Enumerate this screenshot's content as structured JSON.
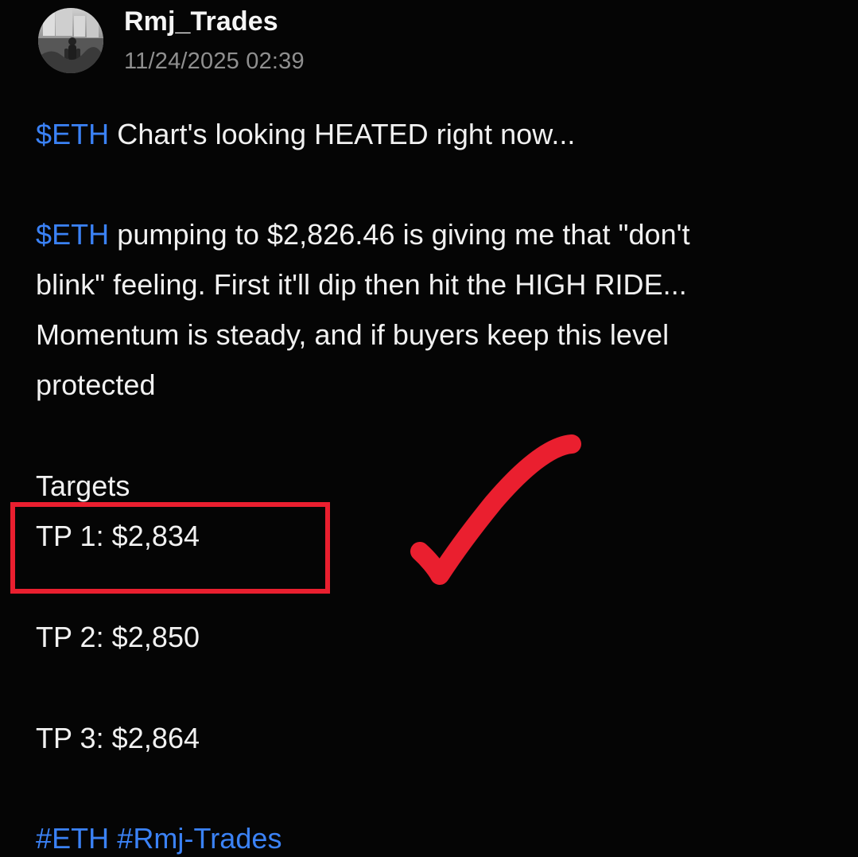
{
  "post": {
    "author": "Rmj_Trades",
    "timestamp": "11/24/2025 02:39",
    "headline": {
      "ticker": "$ETH",
      "text": " Chart's looking HEATED right now..."
    },
    "body": {
      "line1_ticker": "$ETH",
      "line1_text": " pumping to $2,826.46 is giving me that \"don't",
      "line2": "blink\" feeling. First it'll dip then hit the HIGH RIDE...",
      "line3": "Momentum is steady, and if buyers keep this level",
      "line4": "protected"
    },
    "targets_label": "Targets",
    "targets": [
      "TP 1: $2,834",
      "TP 2: $2,850",
      "TP 3: $2,864"
    ],
    "hashtags": "#ETH #Rmj-Trades"
  },
  "colors": {
    "background": "#050505",
    "text": "#f1f1f1",
    "muted": "#8f8f8f",
    "link": "#3b82f6",
    "annotation": "#ea1f2f"
  },
  "icons": {
    "checkmark": "red-checkmark-annotation",
    "avatar": "profile-photo"
  }
}
